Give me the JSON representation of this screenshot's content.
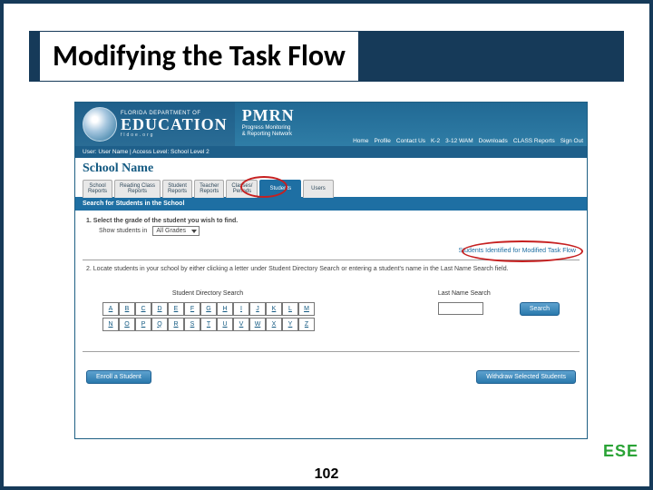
{
  "slide": {
    "title": "Modifying the Task Flow",
    "page_number": "102",
    "badge": "ESE"
  },
  "header": {
    "edu_small": "FLORIDA DEPARTMENT OF",
    "edu_big": "EDUCATION",
    "edu_site": "fldoe.org",
    "pmrn_title": "PMRN",
    "pmrn_sub1": "Progress Monitoring",
    "pmrn_sub2": "& Reporting Network",
    "nav": [
      "Home",
      "Profile",
      "Contact Us",
      "K-2",
      "3-12 WAM",
      "Downloads",
      "CLASS Reports",
      "Sign Out"
    ]
  },
  "user_bar": "User: User Name  |  Access Level:  School Level 2",
  "school_name": "School Name",
  "tabs": [
    {
      "label": "School\nReports"
    },
    {
      "label": "Reading Class\nReports"
    },
    {
      "label": "Student\nReports"
    },
    {
      "label": "Teacher\nReports"
    },
    {
      "label": "Classes/\nPeriods"
    },
    {
      "label": "Students"
    },
    {
      "label": "Users"
    }
  ],
  "section_bar": "Search for Students in the School",
  "step1": {
    "label": "1. Select the grade of the student you wish to find.",
    "show": "Show students in",
    "select_value": "All Grades"
  },
  "mod_link": "Students Identified for Modified Task Flow",
  "step2": "2. Locate students in your school by either clicking a letter under Student Directory Search or entering a student's name in the Last Name Search field.",
  "cols": {
    "dir_title": "Student Directory Search",
    "last_title": "Last Name Search",
    "letters": [
      "A",
      "B",
      "C",
      "D",
      "E",
      "F",
      "G",
      "H",
      "I",
      "J",
      "K",
      "L",
      "M",
      "N",
      "O",
      "P",
      "Q",
      "R",
      "S",
      "T",
      "U",
      "V",
      "W",
      "X",
      "Y",
      "Z"
    ],
    "search_btn": "Search"
  },
  "buttons": {
    "enroll": "Enroll a Student",
    "withdraw": "Withdraw Selected Students"
  }
}
